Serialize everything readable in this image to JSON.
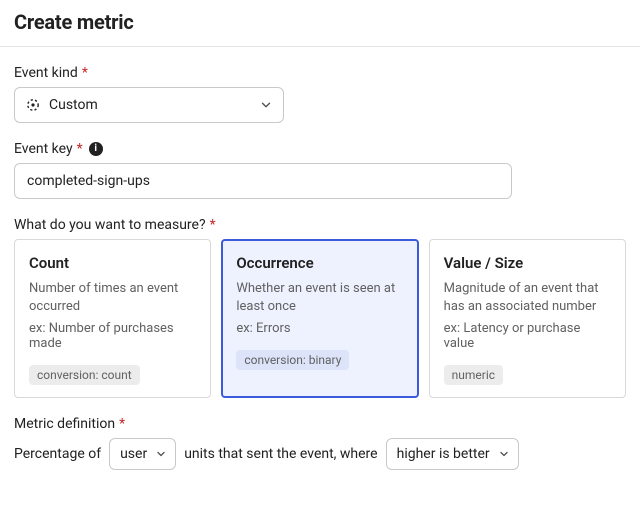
{
  "header": {
    "title": "Create metric"
  },
  "event_kind": {
    "label": "Event kind",
    "value": "Custom"
  },
  "event_key": {
    "label": "Event key",
    "value": "completed-sign-ups"
  },
  "measure": {
    "label": "What do you want to measure?",
    "options": [
      {
        "id": "count",
        "title": "Count",
        "desc": "Number of times an event occurred",
        "example": "ex: Number of purchases made",
        "tag": "conversion: count",
        "selected": false
      },
      {
        "id": "occurrence",
        "title": "Occurrence",
        "desc": "Whether an event is seen at least once",
        "example": "ex: Errors",
        "tag": "conversion: binary",
        "selected": true
      },
      {
        "id": "value",
        "title": "Value / Size",
        "desc": "Magnitude of an event that has an associated number",
        "example": "ex: Latency or purchase value",
        "tag": "numeric",
        "selected": false
      }
    ]
  },
  "definition": {
    "label": "Metric definition",
    "prefix": "Percentage of",
    "unit": "user",
    "middle": "units that sent the event, where",
    "direction": "higher is better"
  }
}
